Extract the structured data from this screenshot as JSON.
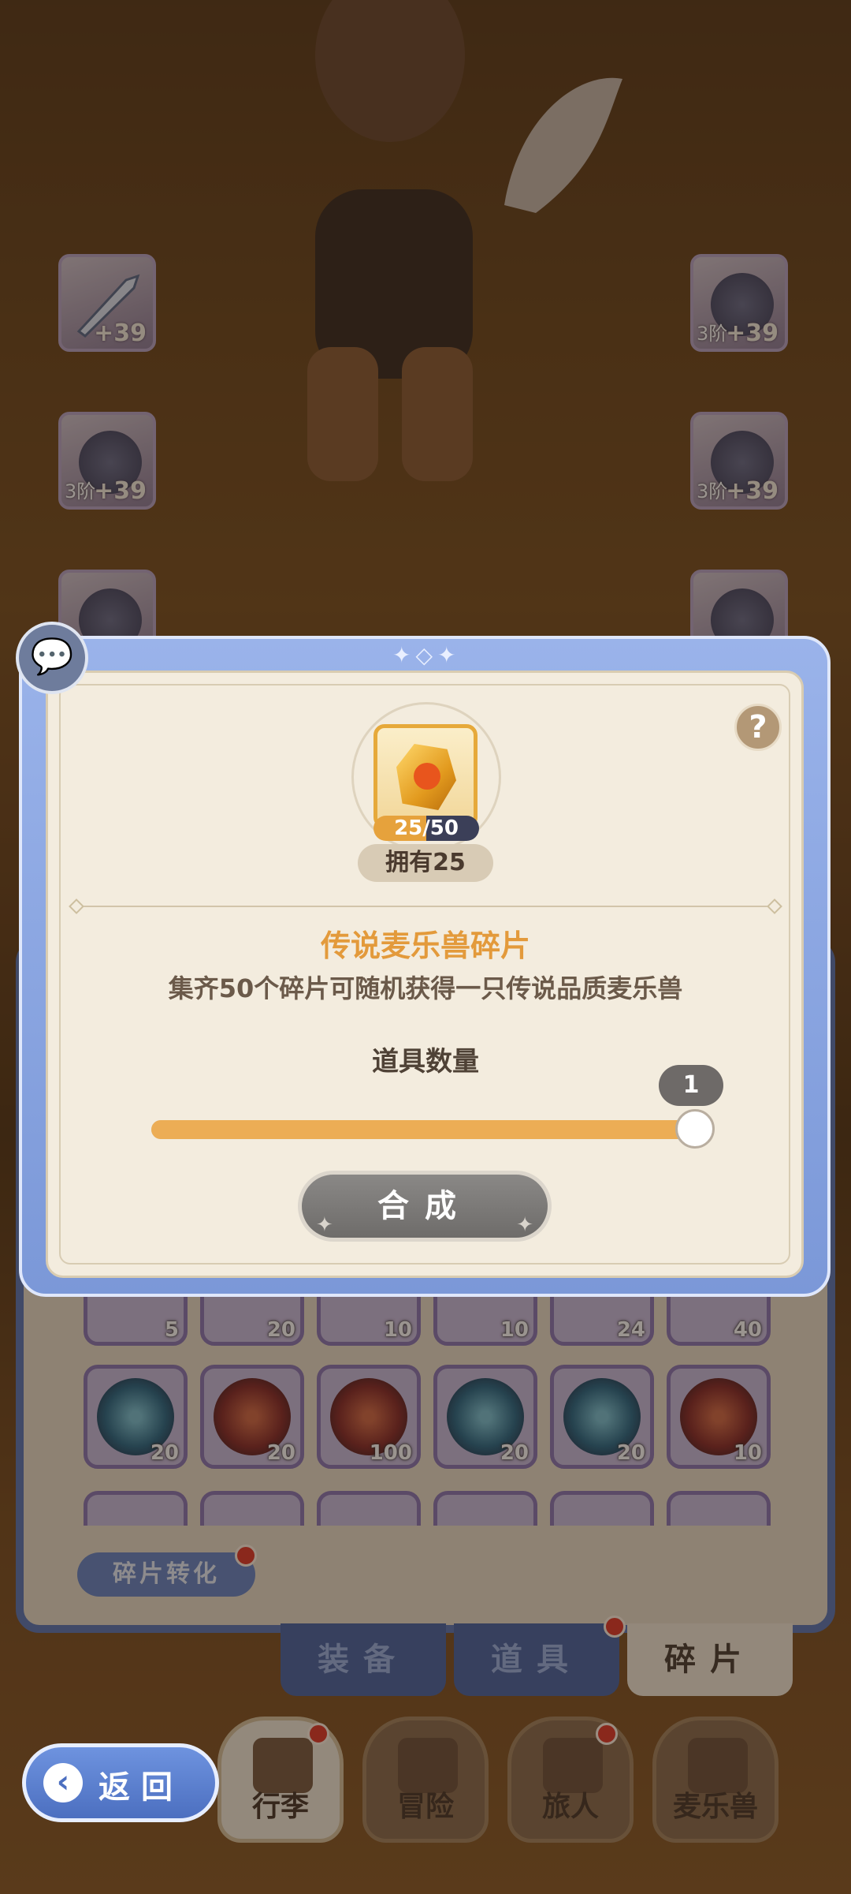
{
  "scene": {
    "equipment_left": [
      {
        "level": "+39",
        "tier": ""
      },
      {
        "level": "+39",
        "tier": "3阶"
      },
      {
        "level": "",
        "tier": ""
      }
    ],
    "equipment_right": [
      {
        "level": "+39",
        "tier": "3阶"
      },
      {
        "level": "+39",
        "tier": "3阶"
      },
      {
        "level": "",
        "tier": ""
      }
    ]
  },
  "inventory": {
    "row_partial_counts": [
      "5",
      "20",
      "10",
      "10",
      "24",
      "40"
    ],
    "row_counts": [
      "20",
      "20",
      "100",
      "20",
      "20",
      "10"
    ],
    "convert_label": "碎片转化"
  },
  "tabs": [
    {
      "label": "装备",
      "active": false
    },
    {
      "label": "道具",
      "active": false
    },
    {
      "label": "碎片",
      "active": true
    }
  ],
  "nav": [
    {
      "label": "行李",
      "active": true
    },
    {
      "label": "冒险",
      "active": false
    },
    {
      "label": "旅人",
      "active": false
    },
    {
      "label": "麦乐兽",
      "active": false
    }
  ],
  "back_button": {
    "label": "返回"
  },
  "dialog": {
    "item_progress_text": "25/50",
    "progress_fraction": 0.5,
    "owned_text": "拥有25",
    "item_name": "传说麦乐兽碎片",
    "item_description": "集齐50个碎片可随机获得一只传说品质麦乐兽",
    "quantity_label": "道具数量",
    "quantity_value": "1",
    "slider_fraction": 1.0,
    "craft_label": "合成",
    "help_symbol": "?"
  },
  "colors": {
    "accent_orange": "#e39a3b",
    "frame_blue": "#7b98d8",
    "slider_fill": "#ecad55"
  }
}
